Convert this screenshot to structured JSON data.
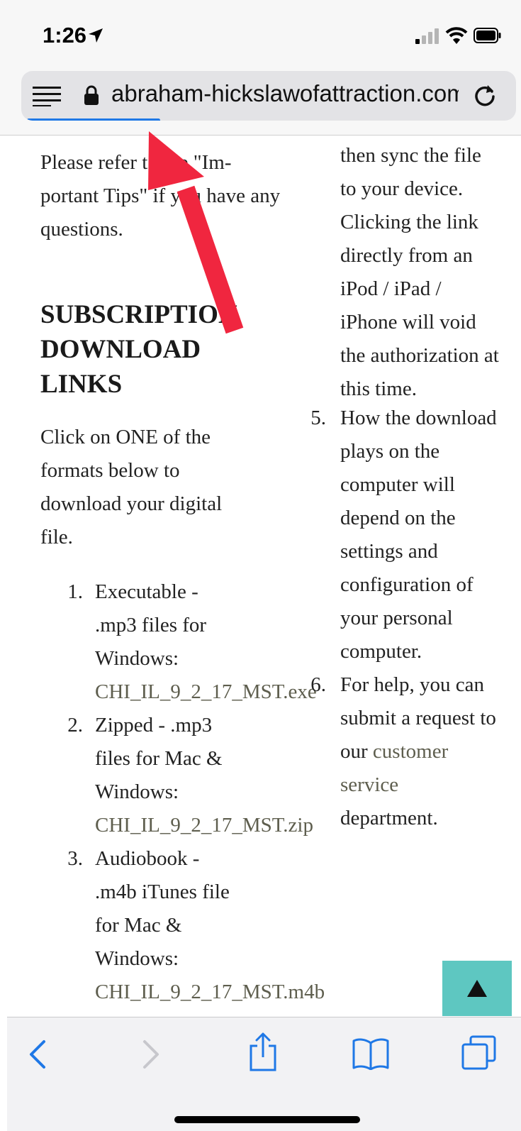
{
  "status_bar": {
    "time": "1:26",
    "icons": [
      "location-arrow-icon",
      "cellular-signal-icon",
      "wifi-icon",
      "battery-icon"
    ]
  },
  "url_bar": {
    "url": "abraham-hickslawofattraction.com",
    "icons": [
      "reader-view-icon",
      "lock-icon",
      "reload-icon"
    ],
    "load_progress": 0.27,
    "accent_color": "#1f78e6"
  },
  "page": {
    "intro": "Please refer to the \"Im-portant Tips\" if you have any questions.",
    "heading": "SUBSCRIPTION DOWNLOAD LINKS",
    "instructions": "Click on ONE of the formats below to download your digital file.",
    "downloads": [
      {
        "num": "1.",
        "label": "Executable - .mp3 files for Windows:",
        "file": "CHI_IL_9_2_17_MST.exe"
      },
      {
        "num": "2.",
        "label": "Zipped - .mp3 files for Mac & Windows:",
        "file": "CHI_IL_9_2_17_MST.zip"
      },
      {
        "num": "3.",
        "label": "Audiobook - .m4b iTunes file for Mac & Windows:",
        "file": "CHI_IL_9_2_17_MST.m4b"
      }
    ],
    "tips_continuation": "then sync the file to your device. Clicking the link directly from an iPod / iPad / iPhone will void the authorization at this time.",
    "tips": [
      {
        "num": "5.",
        "text": "How the download plays on the computer will depend on the settings and configuration of your personal computer."
      },
      {
        "num": "6.",
        "text_before": "For help, you can submit a request to our",
        "link": "customer service",
        "text_after": "department."
      }
    ],
    "back_to_top_icon": "triangle-up-icon",
    "back_to_top_color": "#5ec7c1"
  },
  "toolbar": {
    "icons": [
      "back-icon",
      "forward-icon",
      "share-icon",
      "bookmarks-icon",
      "tabs-icon"
    ],
    "accent_color": "#1f78e6"
  }
}
